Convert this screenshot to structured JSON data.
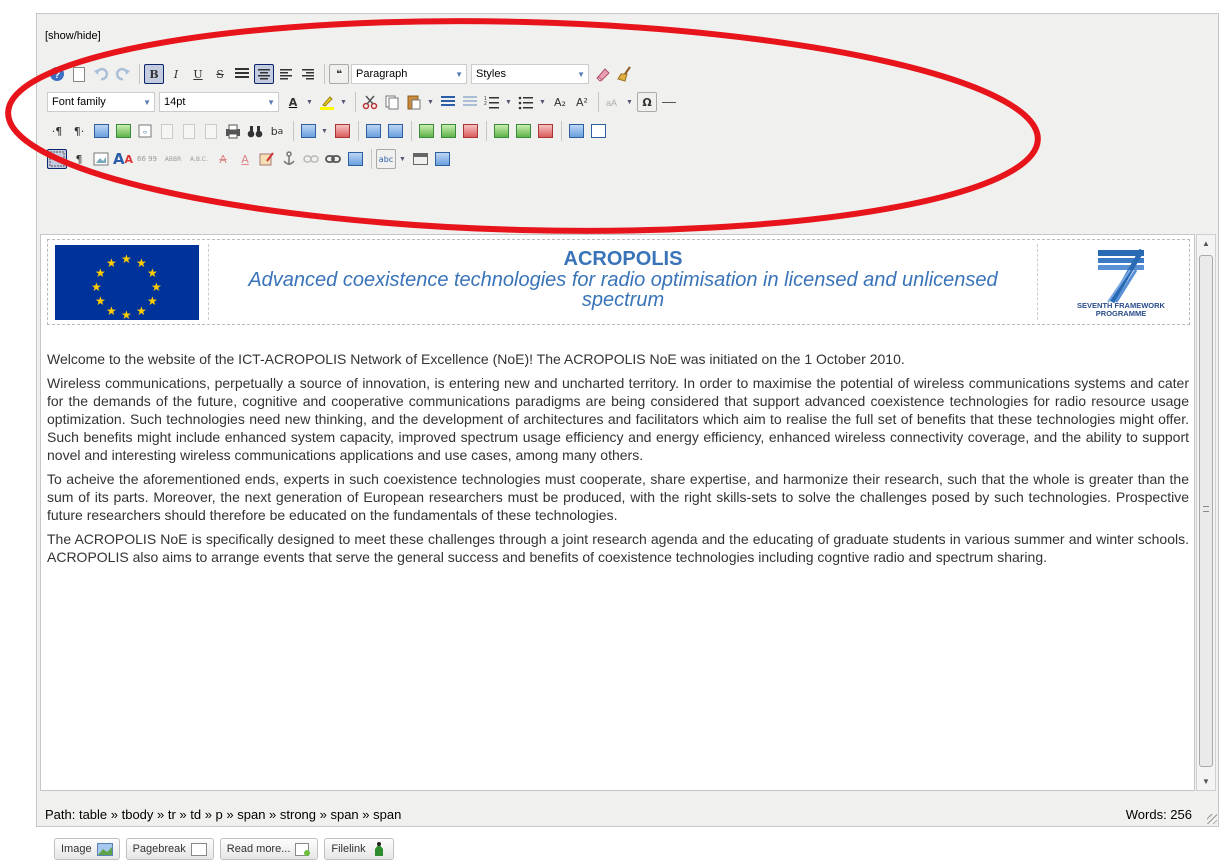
{
  "editor": {
    "show_hide": "[show/hide]",
    "format_select": "Paragraph",
    "styles_select": "Styles",
    "font_family_select": "Font family",
    "font_size_select": "14pt",
    "toolbar": {
      "bold": "B",
      "italic": "I",
      "underline": "U",
      "strike": "S",
      "subscript": "A₂",
      "superscript": "A²",
      "omega": "Ω",
      "ltr": "·¶",
      "rtl": "¶·",
      "quote": "❝",
      "abbr": "ABBR",
      "acronym": "A.B.C.",
      "cite": "66 99",
      "spell": "abc"
    }
  },
  "content": {
    "banner_title": "ACROPOLIS",
    "banner_subtitle": "Advanced coexistence technologies for radio optimisation in licensed and unlicensed spectrum",
    "fp7_text": "SEVENTH FRAMEWORK PROGRAMME",
    "paragraphs": [
      "Welcome to the website of the ICT-ACROPOLIS Network of Excellence (NoE)! The ACROPOLIS NoE was initiated on the 1 October 2010.",
      "Wireless communications, perpetually a source of innovation, is entering new and uncharted territory. In order to maximise the potential of wireless communications systems and cater for the demands of the future, cognitive and cooperative communications paradigms are being considered that support advanced coexistence technologies for radio resource usage optimization. Such technologies need new thinking, and the development of architectures and facilitators which aim to realise the full set of benefits that these technologies might offer. Such benefits might include enhanced system capacity, improved spectrum usage efficiency and energy efficiency, enhanced wireless connectivity coverage, and the ability to support novel and interesting wireless communications applications and use cases, among many others.",
      "To acheive the aforementioned ends, experts in such coexistence technologies must cooperate, share expertise, and harmonize their research, such that the whole is greater than the sum of its parts. Moreover, the next generation of European researchers must be produced, with the right skills-sets to solve the challenges posed by such technologies. Prospective future researchers should therefore be educated on the fundamentals of these technologies.",
      "The ACROPOLIS NoE is specifically designed to meet these challenges through a joint research agenda and the educating of graduate students in various summer and winter schools. ACROPOLIS also aims to arrange events that serve the general success and benefits of coexistence technologies including cogntive radio and spectrum sharing."
    ]
  },
  "status": {
    "path": "Path:  table » tbody » tr » td » p » span » strong » span » span",
    "words": "Words: 256"
  },
  "buttons": {
    "image": "Image",
    "pagebreak": "Pagebreak",
    "readmore": "Read more...",
    "filelink": "Filelink"
  },
  "colors": {
    "accent": "#3973b8",
    "annotation": "#e8141b",
    "eu_blue": "#003399",
    "eu_gold": "#ffcc00"
  }
}
